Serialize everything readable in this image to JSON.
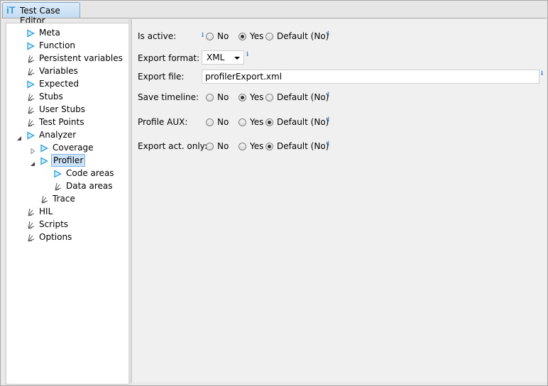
{
  "window": {
    "tab_title": "Test Case Editor",
    "tab_logo": "iT"
  },
  "tree": [
    {
      "label": "Meta",
      "icon": "triangle-icon"
    },
    {
      "label": "Function",
      "icon": "triangle-icon"
    },
    {
      "label": "Persistent variables",
      "icon": "fork-icon"
    },
    {
      "label": "Variables",
      "icon": "fork-icon"
    },
    {
      "label": "Expected",
      "icon": "triangle-icon"
    },
    {
      "label": "Stubs",
      "icon": "fork-icon"
    },
    {
      "label": "User Stubs",
      "icon": "fork-icon"
    },
    {
      "label": "Test Points",
      "icon": "fork-icon"
    },
    {
      "label": "Analyzer",
      "icon": "triangle-icon",
      "expander": "expanded"
    },
    {
      "label": "Coverage",
      "icon": "triangle-icon",
      "expander": "collapsed"
    },
    {
      "label": "Profiler",
      "icon": "triangle-icon",
      "expander": "expanded",
      "selected": true
    },
    {
      "label": "Code areas",
      "icon": "triangle-icon"
    },
    {
      "label": "Data areas",
      "icon": "fork-icon"
    },
    {
      "label": "Trace",
      "icon": "fork-icon"
    },
    {
      "label": "HIL",
      "icon": "fork-icon"
    },
    {
      "label": "Scripts",
      "icon": "fork-icon"
    },
    {
      "label": "Options",
      "icon": "fork-icon"
    }
  ],
  "form": {
    "is_active": {
      "label": "Is active:",
      "options": [
        "No",
        "Yes",
        "Default (No)"
      ],
      "selected": "Yes"
    },
    "export_format": {
      "label": "Export format:",
      "value": "XML"
    },
    "export_file": {
      "label": "Export file:",
      "value": "profilerExport.xml"
    },
    "save_timeline": {
      "label": "Save timeline:",
      "options": [
        "No",
        "Yes",
        "Default (No)"
      ],
      "selected": "Yes"
    },
    "profile_aux": {
      "label": "Profile AUX:",
      "options": [
        "No",
        "Yes",
        "Default (No)"
      ],
      "selected": "Default (No)"
    },
    "export_act_only": {
      "label": "Export act. only:",
      "options": [
        "No",
        "Yes",
        "Default (No)"
      ],
      "selected": "Default (No)"
    },
    "info_marker": "i"
  },
  "colors": {
    "tree_triangle": "#2aa3e0",
    "selection": "#cde4f7",
    "info": "#3a7bc8"
  }
}
